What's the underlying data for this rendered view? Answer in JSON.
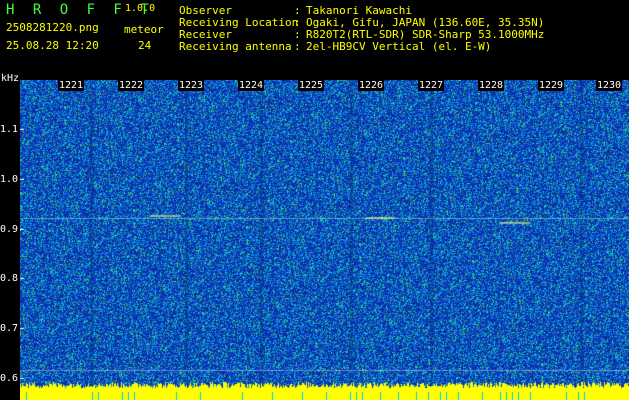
{
  "header": {
    "app_name": "H R O F F T",
    "version": "1.0.0",
    "file_name": "2508281220.png",
    "date_time": "25.08.28 12:20",
    "meteor_label": "meteor",
    "meteor_count": "24",
    "info": [
      {
        "label": "Observer",
        "sep": ":",
        "value": "Takanori Kawachi"
      },
      {
        "label": "Receiving Location",
        "sep": ":",
        "value": "Ogaki, Gifu, JAPAN (136.60E, 35.35N)"
      },
      {
        "label": "Receiver",
        "sep": ":",
        "value": "R820T2(RTL-SDR) SDR-Sharp 53.1000MHz"
      },
      {
        "label": "Receiving antenna",
        "sep": ":",
        "value": "2el-HB9CV Vertical (el. E-W)"
      }
    ]
  },
  "plot": {
    "y_unit": "kHz",
    "y_ticks": [
      "1.1",
      "1.0",
      "0.9",
      "0.8",
      "0.7",
      "0.6"
    ],
    "x_ticks": [
      "1221",
      "1222",
      "1223",
      "1224",
      "1225",
      "1226",
      "1227",
      "1228",
      "1229",
      "1230"
    ],
    "colors": {
      "background": "#0b2fa8",
      "noise_cyan": "#00c8e0",
      "noise_green": "#40e060",
      "signal_yellow": "#ffff00"
    }
  }
}
